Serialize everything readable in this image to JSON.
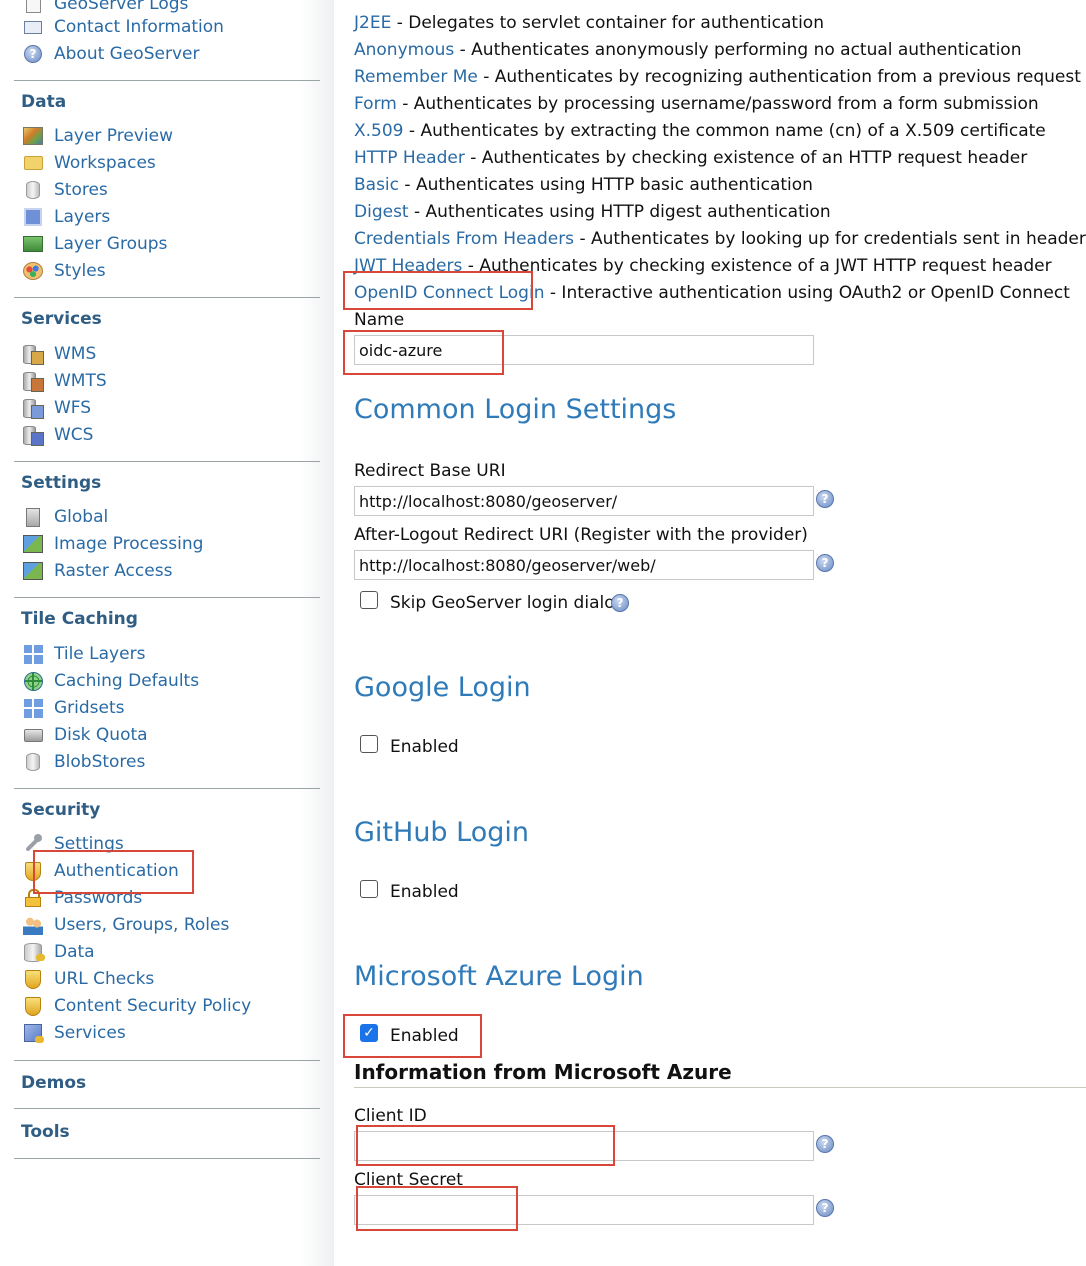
{
  "sidebar": {
    "top_items": [
      {
        "label": "GeoServer Logs",
        "icon": "logs-icon"
      },
      {
        "label": "Contact Information",
        "icon": "contact-card-icon"
      },
      {
        "label": "About GeoServer",
        "icon": "help-icon"
      }
    ],
    "sections": [
      {
        "title": "Data",
        "items": [
          {
            "label": "Layer Preview",
            "icon": "map-icon"
          },
          {
            "label": "Workspaces",
            "icon": "folder-icon"
          },
          {
            "label": "Stores",
            "icon": "database-icon"
          },
          {
            "label": "Layers",
            "icon": "layer-icon"
          },
          {
            "label": "Layer Groups",
            "icon": "layer-group-icon"
          },
          {
            "label": "Styles",
            "icon": "palette-icon"
          }
        ]
      },
      {
        "title": "Services",
        "items": [
          {
            "label": "WMS",
            "icon": "wms-service-icon"
          },
          {
            "label": "WMTS",
            "icon": "wmts-service-icon"
          },
          {
            "label": "WFS",
            "icon": "wfs-service-icon"
          },
          {
            "label": "WCS",
            "icon": "wcs-service-icon"
          }
        ]
      },
      {
        "title": "Settings",
        "items": [
          {
            "label": "Global",
            "icon": "server-icon"
          },
          {
            "label": "Image Processing",
            "icon": "image-processing-icon"
          },
          {
            "label": "Raster Access",
            "icon": "raster-access-icon"
          }
        ]
      },
      {
        "title": "Tile Caching",
        "items": [
          {
            "label": "Tile Layers",
            "icon": "grid-icon"
          },
          {
            "label": "Caching Defaults",
            "icon": "globe-icon"
          },
          {
            "label": "Gridsets",
            "icon": "grid-icon"
          },
          {
            "label": "Disk Quota",
            "icon": "disk-icon"
          },
          {
            "label": "BlobStores",
            "icon": "database-icon"
          }
        ]
      },
      {
        "title": "Security",
        "items": [
          {
            "label": "Settings",
            "icon": "wrench-icon"
          },
          {
            "label": "Authentication",
            "icon": "shield-icon"
          },
          {
            "label": "Passwords",
            "icon": "lock-icon"
          },
          {
            "label": "Users, Groups, Roles",
            "icon": "users-icon"
          },
          {
            "label": "Data",
            "icon": "database-key-icon"
          },
          {
            "label": "URL Checks",
            "icon": "shield-icon"
          },
          {
            "label": "Content Security Policy",
            "icon": "shield-icon"
          },
          {
            "label": "Services",
            "icon": "service-key-icon"
          }
        ]
      },
      {
        "title": "Demos",
        "items": []
      },
      {
        "title": "Tools",
        "items": []
      }
    ]
  },
  "auth_types": [
    {
      "link": "J2EE",
      "desc": " - Delegates to servlet container for authentication"
    },
    {
      "link": "Anonymous",
      "desc": " - Authenticates anonymously performing no actual authentication"
    },
    {
      "link": "Remember Me",
      "desc": " - Authenticates by recognizing authentication from a previous request"
    },
    {
      "link": "Form",
      "desc": " - Authenticates by processing username/password from a form submission"
    },
    {
      "link": "X.509",
      "desc": " - Authenticates by extracting the common name (cn) of a X.509 certificate"
    },
    {
      "link": "HTTP Header",
      "desc": " - Authenticates by checking existence of an HTTP request header"
    },
    {
      "link": "Basic",
      "desc": " - Authenticates using HTTP basic authentication"
    },
    {
      "link": "Digest",
      "desc": " - Authenticates using HTTP digest authentication"
    },
    {
      "link": "Credentials From Headers",
      "desc": " - Authenticates by looking up for credentials sent in headers"
    },
    {
      "link": "JWT Headers",
      "desc": " - Authenticates by checking existence of a JWT HTTP request header"
    },
    {
      "link": "OpenID Connect Login",
      "desc": " - Interactive authentication using OAuth2 or OpenID Connect"
    }
  ],
  "form": {
    "name_label": "Name",
    "name_value": "oidc-azure",
    "common_heading": "Common Login Settings",
    "redirect_label": "Redirect Base URI",
    "redirect_value": "http://localhost:8080/geoserver/",
    "logout_label": "After-Logout Redirect URI (Register with the provider)",
    "logout_value": "http://localhost:8080/geoserver/web/",
    "skip_label": "Skip GeoServer login dialog",
    "google_heading": "Google Login",
    "github_heading": "GitHub Login",
    "azure_heading": "Microsoft Azure Login",
    "enabled_label": "Enabled",
    "azure_info_heading": "Information from Microsoft Azure",
    "client_id_label": "Client ID",
    "client_id_value": "",
    "client_secret_label": "Client Secret",
    "client_secret_value": "",
    "google_enabled": false,
    "github_enabled": false,
    "azure_enabled": true,
    "skip_login": false
  },
  "colors": {
    "link": "#2a6aa4",
    "section_heading": "#2f7ab8",
    "highlight_box": "#d9463a",
    "checkbox_checked": "#1a73e8"
  }
}
